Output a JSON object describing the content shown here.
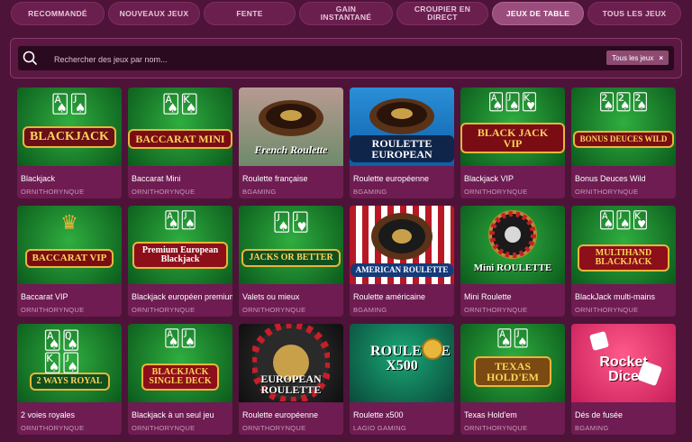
{
  "tabs": [
    {
      "label": "RECOMMANDÉ",
      "active": false
    },
    {
      "label": "NOUVEAUX JEUX",
      "active": false
    },
    {
      "label": "FENTE",
      "active": false
    },
    {
      "label": "GAIN\nINSTANTANÉ",
      "active": false
    },
    {
      "label": "CROUPIER EN\nDIRECT",
      "active": false
    },
    {
      "label": "JEUX DE TABLE",
      "active": true
    },
    {
      "label": "TOUS LES JEUX",
      "active": false
    }
  ],
  "search": {
    "placeholder": "Rechercher des jeux par nom...",
    "value": "",
    "filter_chip_label": "Tous les jeux",
    "filter_chip_close": "×"
  },
  "games": [
    {
      "name": "Blackjack",
      "provider": "ORNITHORYNQUE",
      "logo": "BLACKJACK",
      "theme": "green"
    },
    {
      "name": "Baccarat Mini",
      "provider": "ORNITHORYNQUE",
      "logo": "BACCARAT MINI",
      "theme": "green"
    },
    {
      "name": "Roulette française",
      "provider": "BGAMING",
      "logo": "French Roulette",
      "theme": "roulette-green"
    },
    {
      "name": "Roulette européenne",
      "provider": "BGAMING",
      "logo": "ROULETTE EUROPEAN",
      "theme": "roulette-blue"
    },
    {
      "name": "Blackjack VIP",
      "provider": "ORNITHORYNQUE",
      "logo": "BLACK JACK VIP",
      "theme": "green"
    },
    {
      "name": "Bonus Deuces Wild",
      "provider": "ORNITHORYNQUE",
      "logo": "BONUS DEUCES WILD",
      "theme": "green"
    },
    {
      "name": "Baccarat VIP",
      "provider": "ORNITHORYNQUE",
      "logo": "BACCARAT VIP",
      "theme": "green"
    },
    {
      "name": "Blackjack européen premium",
      "provider": "ORNITHORYNQUE",
      "logo": "Premium European Blackjack",
      "theme": "red"
    },
    {
      "name": "Valets ou mieux",
      "provider": "ORNITHORYNQUE",
      "logo": "JACKS OR BETTER",
      "theme": "green"
    },
    {
      "name": "Roulette américaine",
      "provider": "BGAMING",
      "logo": "AMERICAN ROULETTE",
      "theme": "roulette-red"
    },
    {
      "name": "Mini Roulette",
      "provider": "ORNITHORYNQUE",
      "logo": "Mini ROULETTE",
      "theme": "green"
    },
    {
      "name": "BlackJack multi-mains",
      "provider": "ORNITHORYNQUE",
      "logo": "MULTIHAND BLACKJACK",
      "theme": "red"
    },
    {
      "name": "2 voies royales",
      "provider": "ORNITHORYNQUE",
      "logo": "2 WAYS ROYAL",
      "theme": "green"
    },
    {
      "name": "Blackjack à un seul jeu",
      "provider": "ORNITHORYNQUE",
      "logo": "BLACKJACK SINGLE DECK",
      "theme": "green"
    },
    {
      "name": "Roulette européenne",
      "provider": "ORNITHORYNQUE",
      "logo": "EUROPEAN ROULETTE",
      "theme": "roulette-dark"
    },
    {
      "name": "Roulette x500",
      "provider": "LAGIO GAMING",
      "logo": "ROULETTE X500",
      "theme": "teal"
    },
    {
      "name": "Texas Hold'em",
      "provider": "ORNITHORYNQUE",
      "logo": "TEXAS HOLD'EM",
      "theme": "green"
    },
    {
      "name": "Dés de fusée",
      "provider": "BGAMING",
      "logo": "Rocket Dice",
      "theme": "pink"
    }
  ],
  "colors": {
    "background": "#4e1338",
    "card": "#6e1c52",
    "tab": "#6b1f4f",
    "tab_active": "#9a4d7c"
  }
}
